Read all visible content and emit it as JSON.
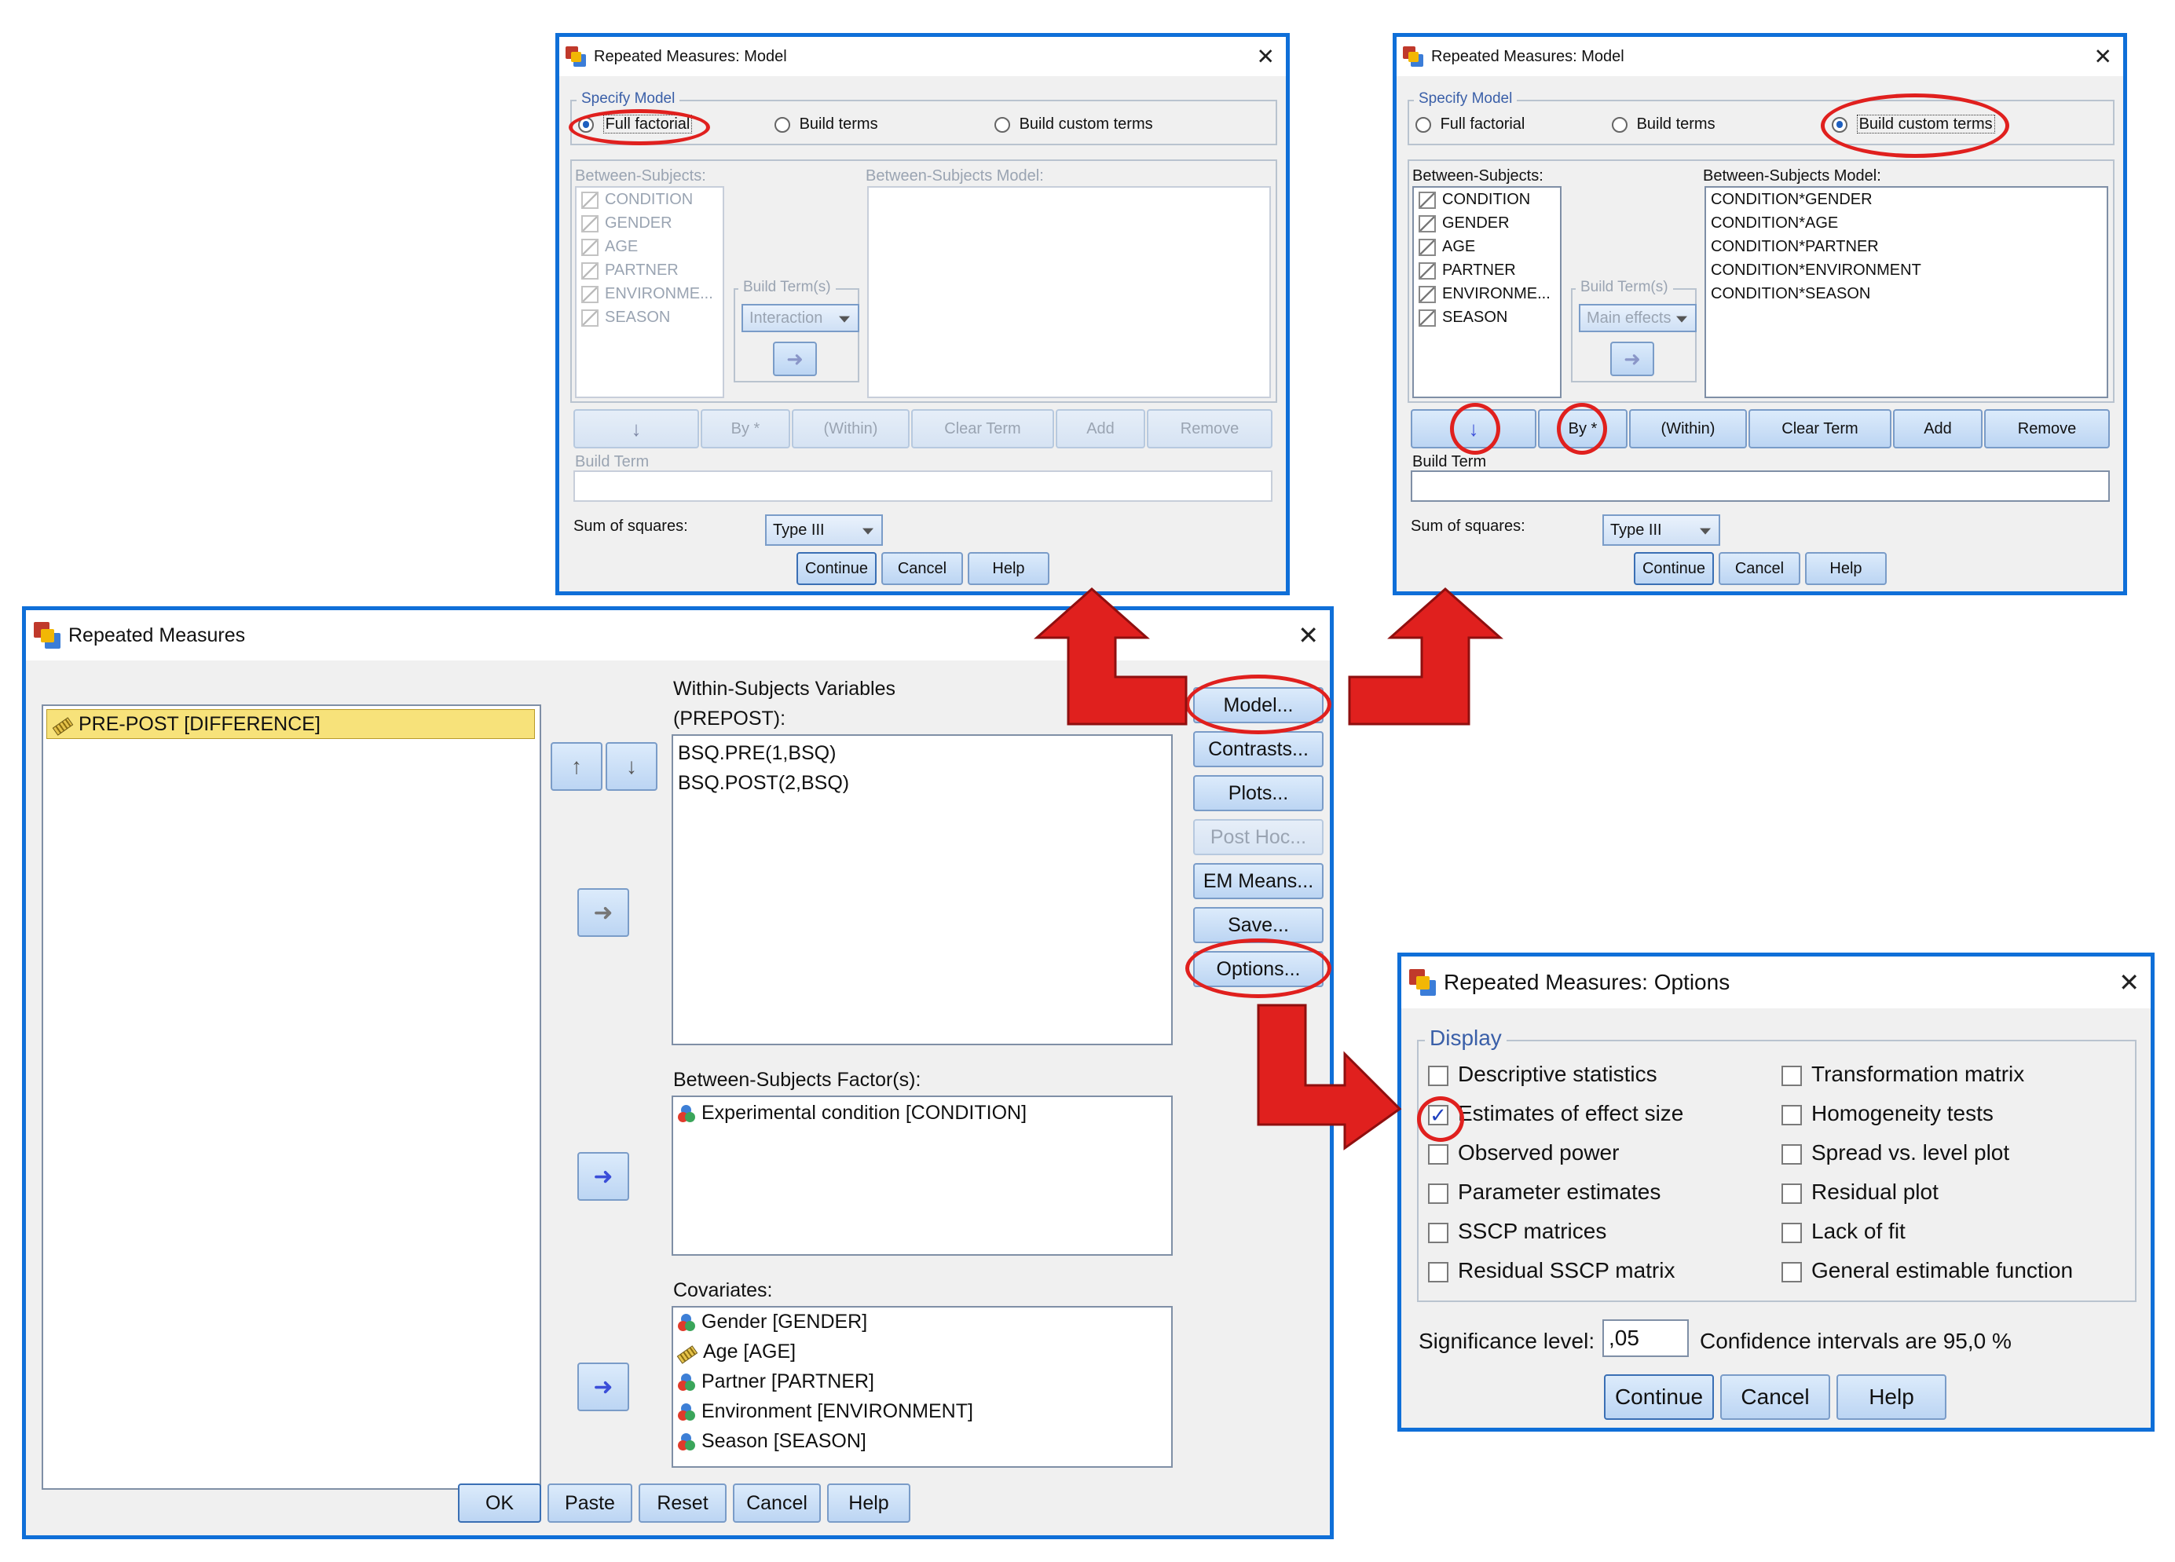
{
  "model_dialog_left": {
    "title": "Repeated Measures: Model",
    "specify_model_label": "Specify Model",
    "radio_full_factorial": "Full factorial",
    "radio_build_terms": "Build terms",
    "radio_build_custom": "Build custom terms",
    "selected": "full_factorial",
    "between_subjects_label": "Between-Subjects:",
    "between_subjects_model_label": "Between-Subjects Model:",
    "variables": [
      "CONDITION",
      "GENDER",
      "AGE",
      "PARTNER",
      "ENVIRONME...",
      "SEASON"
    ],
    "build_terms_label": "Build Term(s)",
    "build_terms_value": "Interaction",
    "buttons": [
      "By *",
      "(Within)",
      "Clear Term",
      "Add",
      "Remove"
    ],
    "build_term_label": "Build Term",
    "sum_of_squares_label": "Sum of squares:",
    "sum_of_squares_value": "Type III",
    "continue": "Continue",
    "cancel": "Cancel",
    "help": "Help"
  },
  "model_dialog_right": {
    "title": "Repeated Measures: Model",
    "specify_model_label": "Specify Model",
    "radio_full_factorial": "Full factorial",
    "radio_build_terms": "Build terms",
    "radio_build_custom": "Build custom terms",
    "selected": "build_custom",
    "between_subjects_label": "Between-Subjects:",
    "between_subjects_model_label": "Between-Subjects Model:",
    "variables": [
      "CONDITION",
      "GENDER",
      "AGE",
      "PARTNER",
      "ENVIRONME...",
      "SEASON"
    ],
    "model_terms": [
      "CONDITION*GENDER",
      "CONDITION*AGE",
      "CONDITION*PARTNER",
      "CONDITION*ENVIRONMENT",
      "CONDITION*SEASON"
    ],
    "build_terms_label": "Build Term(s)",
    "build_terms_value": "Main effects",
    "buttons": [
      "By *",
      "(Within)",
      "Clear Term",
      "Add",
      "Remove"
    ],
    "build_term_label": "Build Term",
    "sum_of_squares_label": "Sum of squares:",
    "sum_of_squares_value": "Type III",
    "continue": "Continue",
    "cancel": "Cancel",
    "help": "Help"
  },
  "main_dialog": {
    "title": "Repeated Measures",
    "source_item": "PRE-POST [DIFFERENCE]",
    "within_label_1": "Within-Subjects Variables",
    "within_label_2": "(PREPOST):",
    "within_items": [
      "BSQ.PRE(1,BSQ)",
      "BSQ.POST(2,BSQ)"
    ],
    "between_label": "Between-Subjects Factor(s):",
    "between_items": [
      "Experimental condition [CONDITION]"
    ],
    "covariates_label": "Covariates:",
    "covariate_items": [
      "Gender [GENDER]",
      "Age [AGE]",
      "Partner [PARTNER]",
      "Environment [ENVIRONMENT]",
      "Season [SEASON]"
    ],
    "side_buttons": [
      "Model...",
      "Contrasts...",
      "Plots...",
      "Post Hoc...",
      "EM Means...",
      "Save...",
      "Options..."
    ],
    "bottom_buttons": [
      "OK",
      "Paste",
      "Reset",
      "Cancel",
      "Help"
    ]
  },
  "options_dialog": {
    "title": "Repeated Measures: Options",
    "display_label": "Display",
    "left_checks": [
      {
        "label": "Descriptive statistics",
        "checked": false
      },
      {
        "label": "Estimates of effect size",
        "checked": true
      },
      {
        "label": "Observed power",
        "checked": false
      },
      {
        "label": "Parameter estimates",
        "checked": false
      },
      {
        "label": "SSCP matrices",
        "checked": false
      },
      {
        "label": "Residual SSCP matrix",
        "checked": false
      }
    ],
    "right_checks": [
      {
        "label": "Transformation matrix",
        "checked": false
      },
      {
        "label": "Homogeneity tests",
        "checked": false
      },
      {
        "label": "Spread vs. level plot",
        "checked": false
      },
      {
        "label": "Residual plot",
        "checked": false
      },
      {
        "label": "Lack of fit",
        "checked": false
      },
      {
        "label": "General estimable function",
        "checked": false
      }
    ],
    "significance_label": "Significance level:",
    "significance_value": ",05",
    "confidence_text": "Confidence intervals are 95,0 %",
    "continue": "Continue",
    "cancel": "Cancel",
    "help": "Help"
  },
  "colors": {
    "window_border": "#0f6fd8",
    "highlight_ring": "#e0201e",
    "arrow_fill": "#e0201e",
    "selected_item": "#f7e27a"
  }
}
